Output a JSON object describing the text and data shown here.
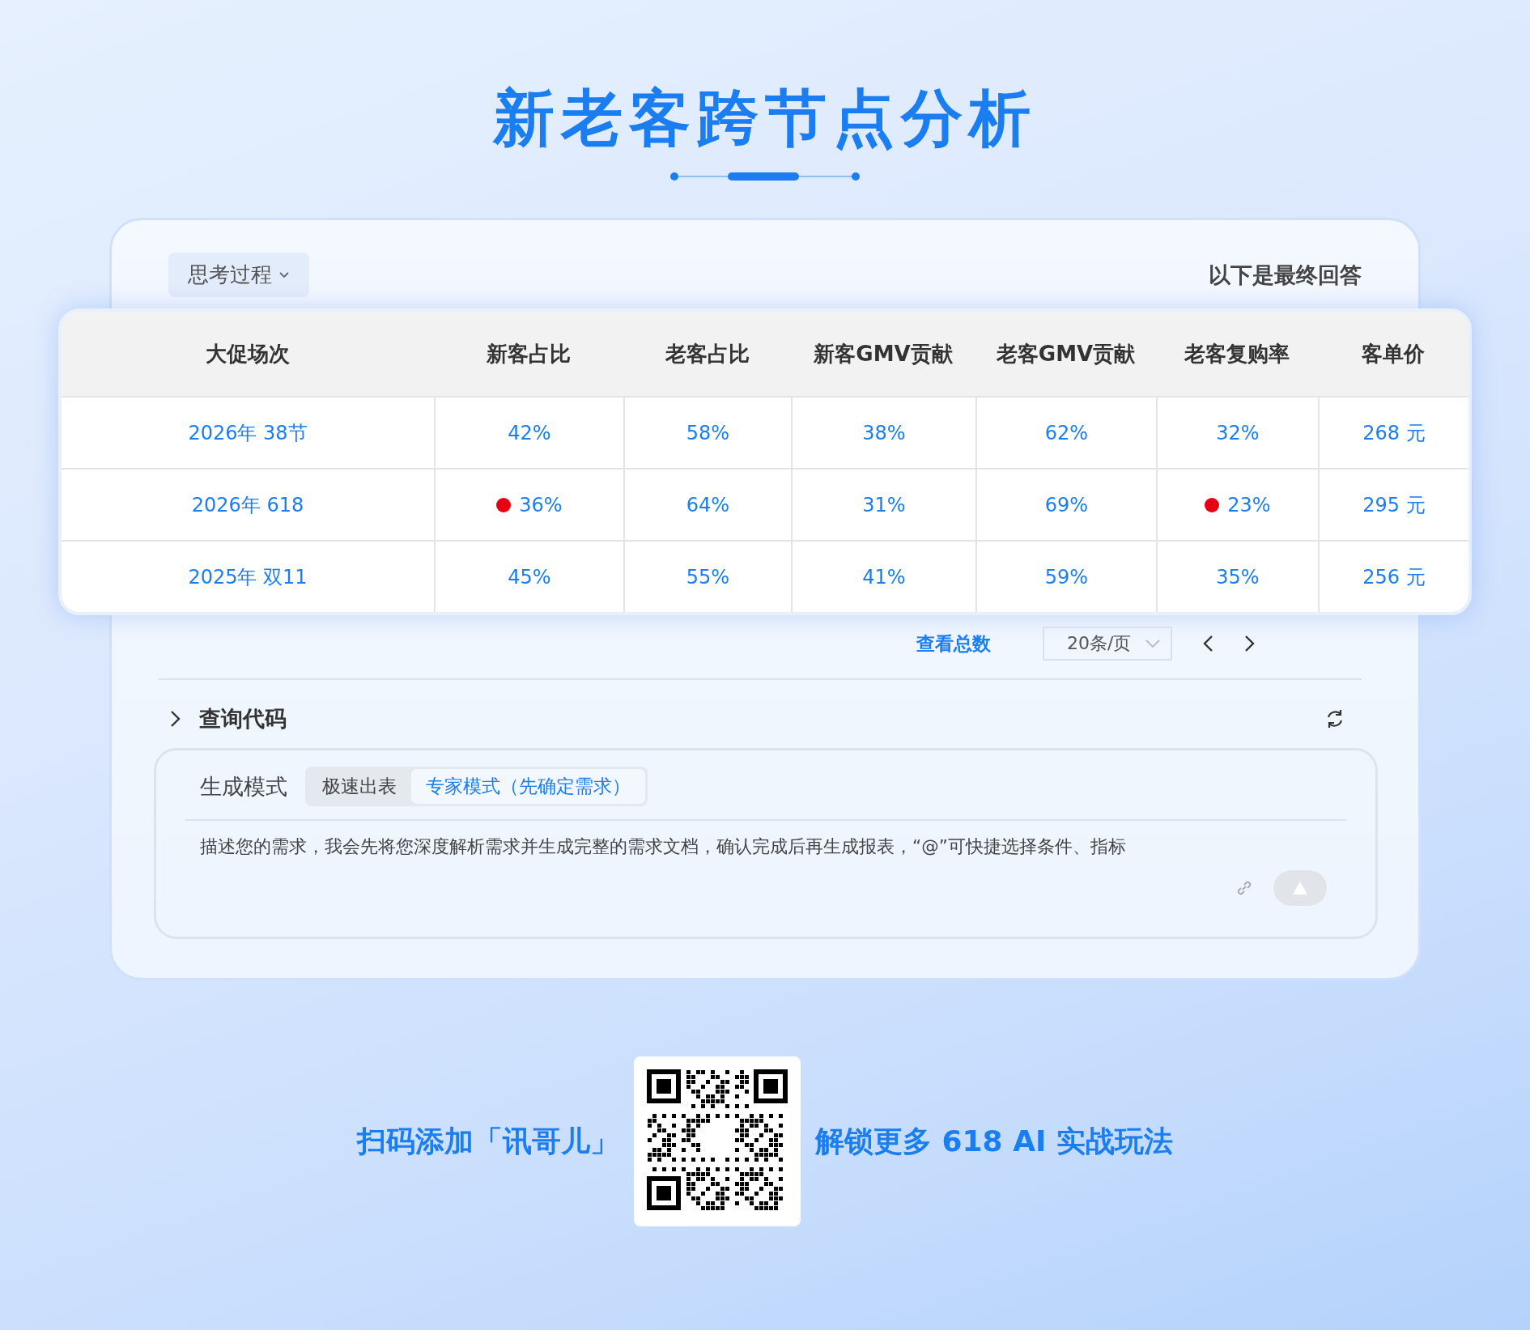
{
  "title": "新老客跨节点分析",
  "card": {
    "thinking_toggle": "思考过程",
    "final_answer_label": "以下是最终回答"
  },
  "table": {
    "columns": [
      "大促场次",
      "新客占比",
      "老客占比",
      "新客GMV贡献",
      "老客GMV贡献",
      "老客复购率",
      "客单价"
    ],
    "rows": [
      {
        "cells": [
          {
            "text": "2026年 38节",
            "flagged": false
          },
          {
            "text": "42%",
            "flagged": false
          },
          {
            "text": "58%",
            "flagged": false
          },
          {
            "text": "38%",
            "flagged": false
          },
          {
            "text": "62%",
            "flagged": false
          },
          {
            "text": "32%",
            "flagged": false
          },
          {
            "text": "268 元",
            "flagged": false
          }
        ]
      },
      {
        "cells": [
          {
            "text": "2026年 618",
            "flagged": false
          },
          {
            "text": "36%",
            "flagged": true
          },
          {
            "text": "64%",
            "flagged": false
          },
          {
            "text": "31%",
            "flagged": false
          },
          {
            "text": "69%",
            "flagged": false
          },
          {
            "text": "23%",
            "flagged": true
          },
          {
            "text": "295 元",
            "flagged": false
          }
        ]
      },
      {
        "cells": [
          {
            "text": "2025年 双11",
            "flagged": false
          },
          {
            "text": "45%",
            "flagged": false
          },
          {
            "text": "55%",
            "flagged": false
          },
          {
            "text": "41%",
            "flagged": false
          },
          {
            "text": "59%",
            "flagged": false
          },
          {
            "text": "35%",
            "flagged": false
          },
          {
            "text": "256 元",
            "flagged": false
          }
        ]
      }
    ]
  },
  "pagination": {
    "total_link": "查看总数",
    "page_size": "20条/页"
  },
  "query_code": {
    "label": "查询代码",
    "expanded": false
  },
  "composer": {
    "mode_label": "生成模式",
    "modes": [
      {
        "label": "极速出表",
        "selected": false
      },
      {
        "label": "专家模式（先确定需求）",
        "selected": true
      }
    ],
    "placeholder": "描述您的需求，我会先将您深度解析需求并生成完整的需求文档，确认完成后再生成报表，“@”可快捷选择条件、指标"
  },
  "footer": {
    "left": "扫码添加「讯哥儿」",
    "right": "解锁更多 618 AI 实战玩法"
  }
}
